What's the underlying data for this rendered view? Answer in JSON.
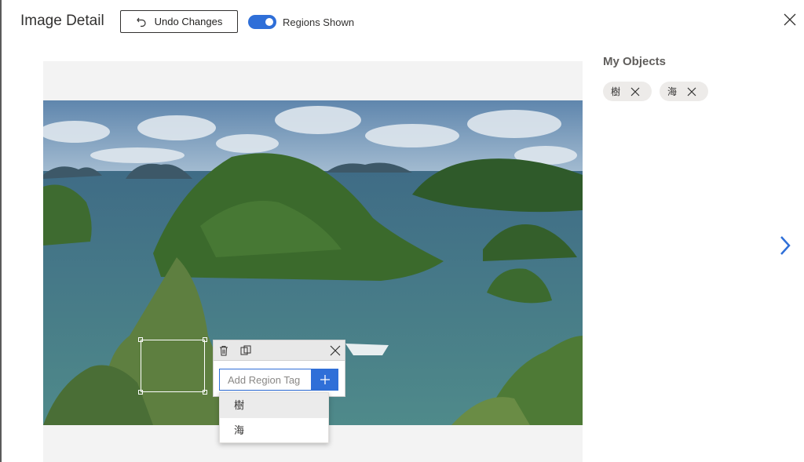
{
  "header": {
    "title": "Image Detail",
    "undo_label": "Undo Changes",
    "toggle_label": "Regions Shown",
    "toggle_on": true
  },
  "region_popup": {
    "input_placeholder": "Add Region Tag",
    "suggestions": [
      "樹",
      "海"
    ]
  },
  "objects_panel": {
    "title": "My Objects",
    "tags": [
      "樹",
      "海"
    ]
  },
  "icons": {
    "undo": "undo-icon",
    "close": "close-icon",
    "delete": "trash-icon",
    "copy": "copy-region-icon",
    "add": "plus-icon",
    "remove_tag": "close-icon",
    "next": "chevron-right-icon"
  },
  "colors": {
    "accent": "#2f6fd8",
    "chip_bg": "#edebe9",
    "canvas_bg": "#f3f3f3"
  }
}
